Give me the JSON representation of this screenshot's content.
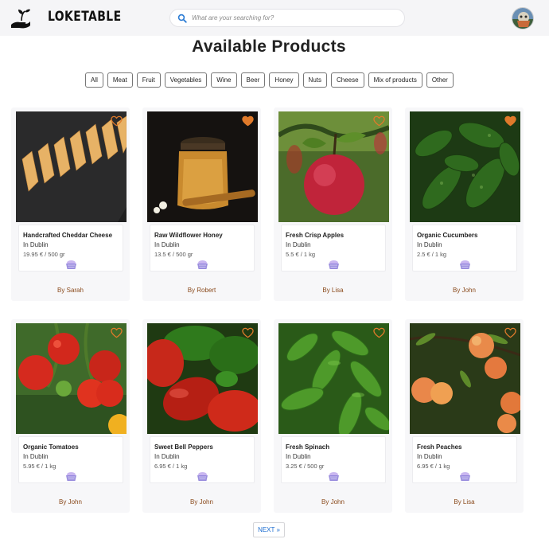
{
  "header": {
    "brand": "LOKETABLE",
    "search_placeholder": "What are your searching for?"
  },
  "page_title": "Available Products",
  "filters": [
    "All",
    "Meat",
    "Fruit",
    "Vegetables",
    "Wine",
    "Beer",
    "Honey",
    "Nuts",
    "Cheese",
    "Mix of products",
    "Other"
  ],
  "products": [
    {
      "name": "Handcrafted Cheddar Cheese",
      "location": "In Dublin",
      "price": "19.95 € / 500 gr",
      "seller": "By Sarah",
      "image": "cheese",
      "favorited": false
    },
    {
      "name": "Raw Wildflower Honey",
      "location": "In Dublin",
      "price": "13.5 € / 500 gr",
      "seller": "By Robert",
      "image": "honey",
      "favorited": true
    },
    {
      "name": "Fresh Crisp Apples",
      "location": "In Dublin",
      "price": "5.5 € / 1 kg",
      "seller": "By Lisa",
      "image": "apple",
      "favorited": false
    },
    {
      "name": "Organic Cucumbers",
      "location": "In Dublin",
      "price": "2.5 € / 1 kg",
      "seller": "By John",
      "image": "cucumbers",
      "favorited": true
    },
    {
      "name": "Organic Tomatoes",
      "location": "In Dublin",
      "price": "5.95 € / 1 kg",
      "seller": "By John",
      "image": "tomatoes",
      "favorited": false
    },
    {
      "name": "Sweet Bell Peppers",
      "location": "In Dublin",
      "price": "6.95 € / 1 kg",
      "seller": "By John",
      "image": "peppers",
      "favorited": false
    },
    {
      "name": "Fresh Spinach",
      "location": "In Dublin",
      "price": "3.25 € / 500 gr",
      "seller": "By John",
      "image": "spinach",
      "favorited": false
    },
    {
      "name": "Fresh Peaches",
      "location": "In Dublin",
      "price": "6.95 € / 1 kg",
      "seller": "By Lisa",
      "image": "peaches",
      "favorited": false
    }
  ],
  "pagination": {
    "next_label": "NEXT »"
  },
  "colors": {
    "accent": "#e07a2b",
    "seller": "#8a4a1c",
    "link": "#1f6fd1",
    "heart_outline": "#e07a2b"
  }
}
